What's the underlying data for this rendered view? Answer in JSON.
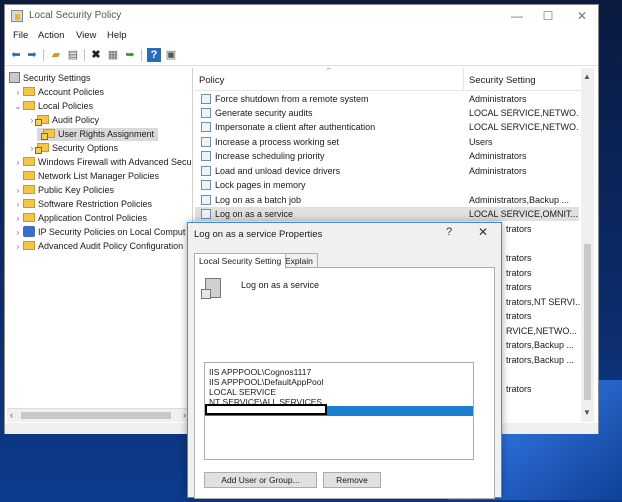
{
  "window": {
    "title": "Local Security Policy",
    "controls": {
      "minimize": "—",
      "maximize": "☐",
      "close": "✕"
    }
  },
  "menu": {
    "file": "File",
    "action": "Action",
    "view": "View",
    "help": "Help"
  },
  "toolbar": {
    "icons": [
      "back-arrow-icon",
      "forward-arrow-icon",
      "up-folder-icon",
      "show-hide-tree-icon",
      "delete-icon",
      "properties-icon",
      "export-list-icon",
      "help-icon",
      "mmc-view-icon"
    ]
  },
  "tree": {
    "root": "Security Settings",
    "account_policies": "Account Policies",
    "local_policies": "Local Policies",
    "audit_policy": "Audit Policy",
    "user_rights": "User Rights Assignment",
    "security_options": "Security Options",
    "firewall": "Windows Firewall with Advanced Secu",
    "network_list": "Network List Manager Policies",
    "public_key": "Public Key Policies",
    "software_restriction": "Software Restriction Policies",
    "app_control": "Application Control Policies",
    "ip_security": "IP Security Policies on Local Comput",
    "advanced_audit": "Advanced Audit Policy Configuration"
  },
  "list": {
    "col_policy": "Policy",
    "col_setting": "Security Setting",
    "rows": [
      {
        "policy": "Force shutdown from a remote system",
        "setting": "Administrators"
      },
      {
        "policy": "Generate security audits",
        "setting": "LOCAL SERVICE,NETWO..."
      },
      {
        "policy": "Impersonate a client after authentication",
        "setting": "LOCAL SERVICE,NETWO..."
      },
      {
        "policy": "Increase a process working set",
        "setting": "Users"
      },
      {
        "policy": "Increase scheduling priority",
        "setting": "Administrators"
      },
      {
        "policy": "Load and unload device drivers",
        "setting": "Administrators"
      },
      {
        "policy": "Lock pages in memory",
        "setting": ""
      },
      {
        "policy": "Log on as a batch job",
        "setting": "Administrators,Backup ..."
      },
      {
        "policy": "Log on as a service",
        "setting": "LOCAL SERVICE,OMNIT..."
      }
    ],
    "peek_settings": [
      "trators",
      "trators",
      "trators",
      "trators",
      "trators,NT SERVI...",
      "trators",
      "RVICE,NETWO...",
      "trators,Backup ...",
      "trators,Backup ...",
      "trators"
    ]
  },
  "dialog": {
    "title": "Log on as a service Properties",
    "help": "?",
    "close": "✕",
    "tab_local": "Local Security Setting",
    "tab_explain": "Explain",
    "policy_name": "Log on as a service",
    "accounts": [
      "IIS APPPOOL\\Cognos1117",
      "IIS APPPOOL\\DefaultAppPool",
      "LOCAL SERVICE",
      "NT SERVICE\\ALL SERVICES"
    ],
    "add_button": "Add User or Group...",
    "remove_button": "Remove"
  },
  "colors": {
    "selection_blue": "#1a7fd0",
    "dialog_border": "#3d8be0",
    "folder_yellow": "#f3c64a"
  }
}
